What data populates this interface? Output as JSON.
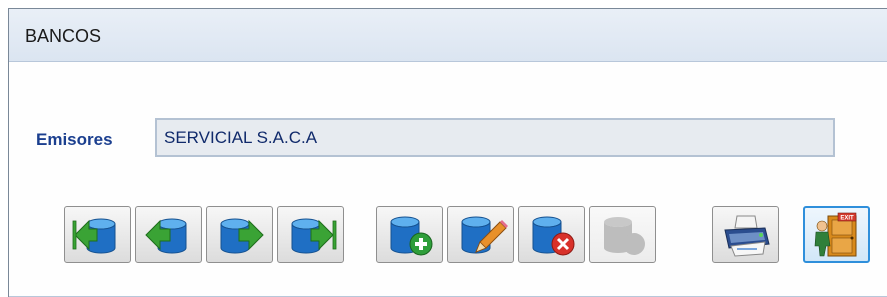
{
  "window": {
    "title": "BANCOS"
  },
  "form": {
    "emisores_label": "Emisores",
    "emisores_value": "SERVICIAL S.A.C.A"
  },
  "toolbar": {
    "buttons": [
      {
        "name": "first-record",
        "icon": "db-first-icon"
      },
      {
        "name": "previous-record",
        "icon": "db-previous-icon"
      },
      {
        "name": "next-record",
        "icon": "db-next-icon"
      },
      {
        "name": "last-record",
        "icon": "db-last-icon"
      },
      {
        "name": "add-record",
        "icon": "db-add-icon"
      },
      {
        "name": "edit-record",
        "icon": "db-edit-icon"
      },
      {
        "name": "delete-record",
        "icon": "db-delete-icon"
      },
      {
        "name": "disabled-action",
        "icon": "db-disabled-icon"
      },
      {
        "name": "print",
        "icon": "printer-icon"
      },
      {
        "name": "exit",
        "icon": "exit-door-icon",
        "selected": true,
        "sign_text": "EXIT"
      }
    ],
    "colors": {
      "db_blue": "#1f6fc4",
      "arrow_green": "#3aa335",
      "add_green": "#2e9e3a",
      "delete_red": "#d8312a",
      "pencil_orange": "#e8902a",
      "door_orange": "#d88a1c"
    }
  }
}
